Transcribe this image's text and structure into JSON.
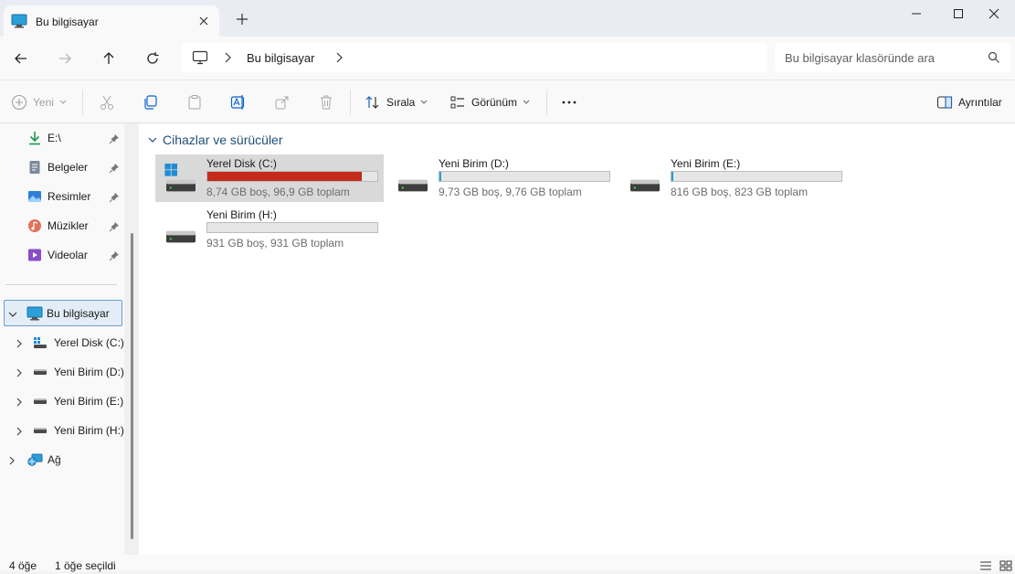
{
  "window": {
    "tab_title": "Bu bilgisayar",
    "icons": {
      "tab": "computer-icon",
      "close_tab": "close-icon",
      "new_tab": "plus-icon",
      "minimize": "minimize-icon",
      "maximize": "maximize-icon",
      "close": "close-icon"
    }
  },
  "navigation": {
    "breadcrumb": "Bu bilgisayar",
    "search_placeholder": "Bu bilgisayar klasöründe ara",
    "icons": [
      "back-icon",
      "forward-icon",
      "up-icon",
      "refresh-icon",
      "search-icon"
    ]
  },
  "toolbar": {
    "new_label": "Yeni",
    "sort_label": "Sırala",
    "view_label": "Görünüm",
    "more_label": "...",
    "details_label": "Ayrıntılar"
  },
  "sidebar": {
    "quick_access": [
      {
        "label": "E:\\",
        "icon": "download-icon"
      },
      {
        "label": "Belgeler",
        "icon": "document-icon"
      },
      {
        "label": "Resimler",
        "icon": "pictures-icon"
      },
      {
        "label": "Müzikler",
        "icon": "music-icon"
      },
      {
        "label": "Videolar",
        "icon": "video-icon"
      }
    ],
    "this_pc": "Bu bilgisayar",
    "drives": [
      {
        "label": "Yerel Disk (C:)"
      },
      {
        "label": "Yeni Birim (D:)"
      },
      {
        "label": "Yeni Birim (E:)"
      },
      {
        "label": "Yeni Birim (H:)"
      }
    ],
    "network": "Ağ"
  },
  "main": {
    "group_title": "Cihazlar ve sürücüler",
    "drives": [
      {
        "name": "Yerel Disk (C:)",
        "info": "8,74 GB boş, 96,9 GB toplam",
        "used_fraction": 0.91,
        "bar_color": "#c42b1c",
        "selected": true,
        "windows": true
      },
      {
        "name": "Yeni Birim (D:)",
        "info": "9,73 GB boş, 9,76 GB toplam",
        "used_fraction": 0.003,
        "bar_color": "#26a0da",
        "selected": false,
        "windows": false
      },
      {
        "name": "Yeni Birim (E:)",
        "info": "816 GB boş, 823 GB toplam",
        "used_fraction": 0.009,
        "bar_color": "#26a0da",
        "selected": false,
        "windows": false
      },
      {
        "name": "Yeni Birim (H:)",
        "info": "931 GB boş, 931 GB toplam",
        "used_fraction": 0.0,
        "bar_color": "#26a0da",
        "selected": false,
        "windows": false
      }
    ]
  },
  "status": {
    "item_count": "4 öğe",
    "selected_count": "1 öğe seçildi"
  },
  "colors": {
    "accent": "#0067c0",
    "selection": "#d9d9d9",
    "low_space": "#c42b1c",
    "normal_space": "#26a0da"
  }
}
